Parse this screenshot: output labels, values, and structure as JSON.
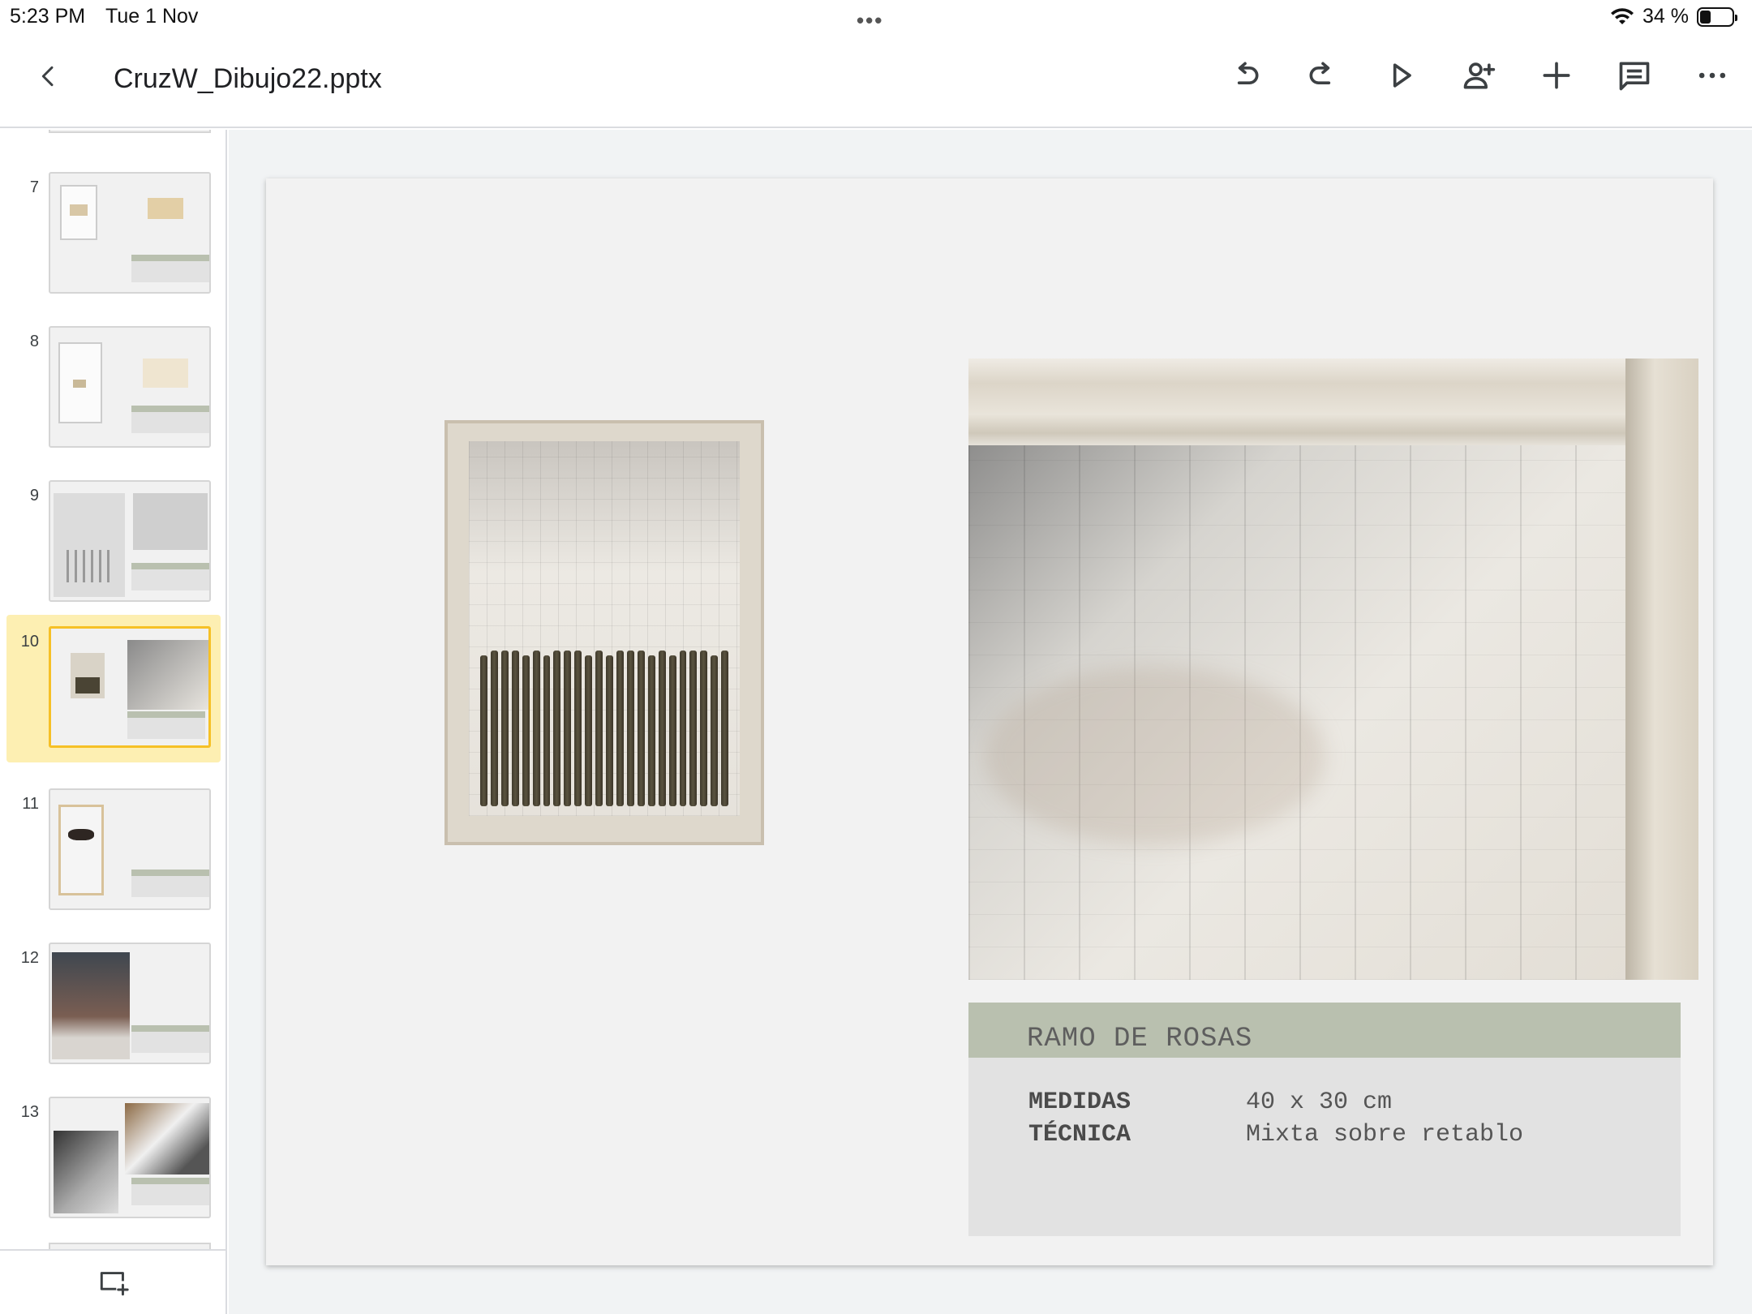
{
  "status": {
    "time": "5:23 PM",
    "date": "Tue 1 Nov",
    "dots": "•••",
    "battery": "34 %",
    "battery_level": 0.34
  },
  "toolbar": {
    "title": "CruzW_Dibujo22.pptx",
    "icons": [
      "back-icon",
      "undo-icon",
      "redo-icon",
      "play-icon",
      "add-person-icon",
      "plus-icon",
      "comment-icon",
      "more-icon"
    ]
  },
  "thumbnails": [
    {
      "number": "7"
    },
    {
      "number": "8"
    },
    {
      "number": "9"
    },
    {
      "number": "10",
      "selected": true
    },
    {
      "number": "11"
    },
    {
      "number": "12"
    },
    {
      "number": "13"
    }
  ],
  "slide": {
    "caption_title": "RAMO DE ROSAS",
    "rows": [
      {
        "label": "MEDIDAS",
        "value": "40 x 30 cm"
      },
      {
        "label": "TÉCNICA",
        "value": "Mixta sobre retablo"
      }
    ]
  },
  "colors": {
    "selected_highlight": "#fdefb2",
    "selected_border": "#f6c026",
    "caption_band": "#b9c0af",
    "caption_info": "#e2e2e2"
  }
}
